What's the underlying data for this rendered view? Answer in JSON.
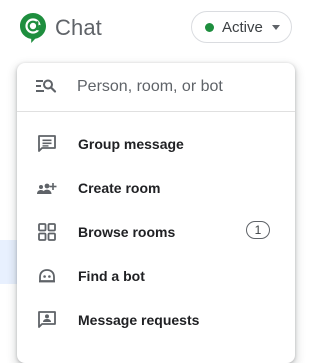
{
  "header": {
    "app_title": "Chat",
    "logo_icon": "google-chat-logo",
    "brand_color": "#1e8e3e",
    "status": {
      "label": "Active",
      "dot_color": "#1e8e3e",
      "caret_icon": "caret-down-icon"
    }
  },
  "menu": {
    "search": {
      "placeholder": "Person, room, or bot",
      "value": "",
      "icon": "person-search-icon"
    },
    "items": [
      {
        "label": "Group message",
        "icon": "group-message-icon"
      },
      {
        "label": "Create room",
        "icon": "create-room-icon"
      },
      {
        "label": "Browse rooms",
        "icon": "browse-rooms-icon",
        "badge": "1"
      },
      {
        "label": "Find a bot",
        "icon": "bot-icon"
      },
      {
        "label": "Message requests",
        "icon": "message-requests-icon"
      }
    ]
  }
}
